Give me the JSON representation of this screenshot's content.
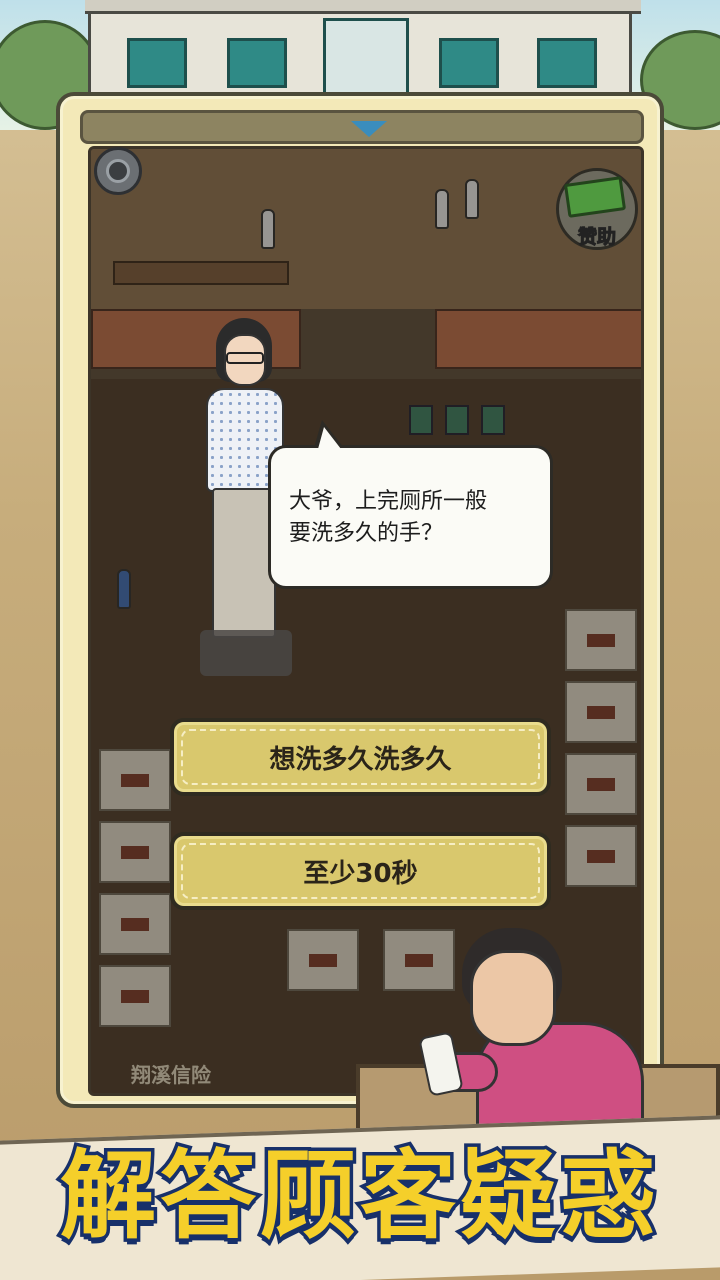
{
  "hud": {
    "settings_icon": "gear-icon",
    "sponsor_label": "赞助",
    "sponsor_icon": "money-stack-icon"
  },
  "dialogue": {
    "question": "大爷，上完厕所一般\n要洗多久的手？"
  },
  "answers": [
    {
      "label": "想洗多久洗多久"
    },
    {
      "label": "至少30秒"
    }
  ],
  "scene": {
    "bottom_sign": "翔溪信险"
  },
  "banner": {
    "caption": "解答顾客疑惑"
  },
  "colors": {
    "answer_button": "#d9c86d",
    "caption_fill": "#f5cf2a",
    "caption_stroke": "#17306a",
    "panel": "#f3e9b8"
  }
}
